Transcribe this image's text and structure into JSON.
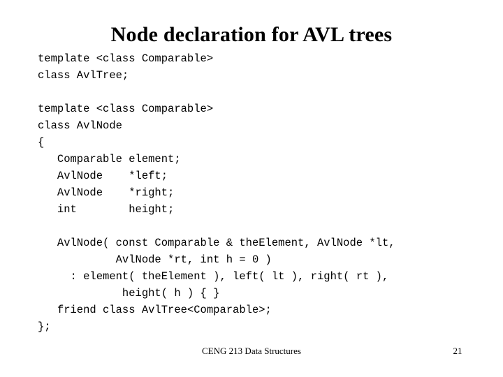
{
  "slide": {
    "title": "Node declaration for AVL trees",
    "background_color": "#ffffff",
    "text_color": "#000000",
    "code_lines": [
      "template <class Comparable>",
      "class AvlTree;",
      "",
      "template <class Comparable>",
      "class AvlNode",
      "{",
      "   Comparable element;",
      "   AvlNode    *left;",
      "   AvlNode    *right;",
      "   int        height;",
      "",
      "   AvlNode( const Comparable & theElement, AvlNode *lt,",
      "            AvlNode *rt, int h = 0 )",
      "     : element( theElement ), left( lt ), right( rt ),",
      "             height( h ) { }",
      "   friend class AvlTree<Comparable>;",
      "};"
    ],
    "footer": {
      "course": "CENG 213 Data Structures",
      "page_number": "21"
    }
  }
}
